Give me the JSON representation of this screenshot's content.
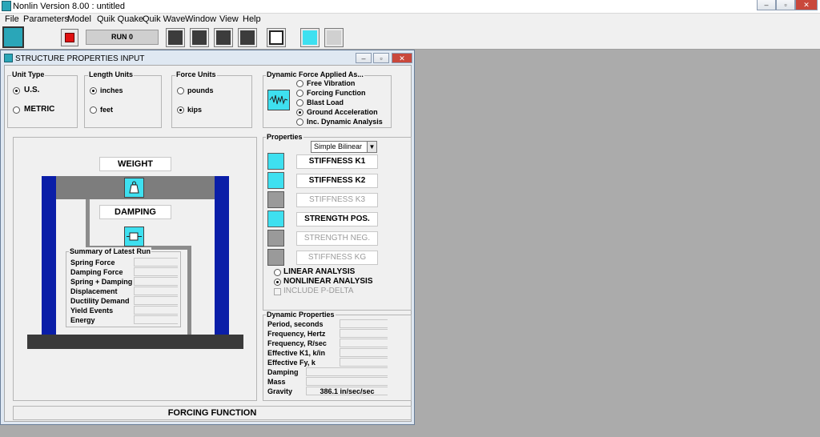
{
  "app": {
    "title": "Nonlin Version 8.00 : untitled"
  },
  "menu": [
    "File",
    "Parameters",
    "Model",
    "Quik Quake",
    "Quik Wave",
    "Window",
    "View",
    "Help"
  ],
  "toolbar": {
    "run_label": "RUN  0"
  },
  "window": {
    "title": "STRUCTURE PROPERTIES INPUT"
  },
  "unit_type": {
    "label": "Unit Type",
    "options": [
      "U.S.",
      "METRIC"
    ],
    "selected": "U.S."
  },
  "length_units": {
    "label": "Length Units",
    "options": [
      "inches",
      "feet"
    ],
    "selected": "inches"
  },
  "force_units": {
    "label": "Force Units",
    "options": [
      "pounds",
      "kips"
    ],
    "selected": "kips"
  },
  "dynamic_force": {
    "label": "Dynamic Force Applied As...",
    "options": [
      "Free Vibration",
      "Forcing Function",
      "Blast Load",
      "Ground Acceleration",
      "Inc. Dynamic Analysis"
    ],
    "selected": "Ground Acceleration"
  },
  "diagram": {
    "weight_label": "WEIGHT",
    "damping_label": "DAMPING"
  },
  "summary": {
    "title": "Summary of Latest Run",
    "rows": [
      "Spring Force",
      "Damping Force",
      "Spring + Damping",
      "Displacement",
      "Ductility Demand",
      "Yield Events",
      "Energy"
    ]
  },
  "properties": {
    "label": "Properties",
    "model_select": "Simple Bilinear",
    "fields": [
      "STIFFNESS K1",
      "STIFFNESS K2",
      "STIFFNESS K3",
      "STRENGTH POS.",
      "STRENGTH NEG.",
      "STIFFNESS KG"
    ],
    "enabled": [
      true,
      true,
      false,
      true,
      false,
      false
    ],
    "analysis_options": [
      "LINEAR ANALYSIS",
      "NONLINEAR ANALYSIS"
    ],
    "analysis_selected": "NONLINEAR ANALYSIS",
    "p_delta_label": "INCLUDE P-DELTA"
  },
  "dynamic_properties": {
    "label": "Dynamic Properties",
    "rows": [
      {
        "label": "Period, seconds",
        "value": ""
      },
      {
        "label": "Frequency, Hertz",
        "value": ""
      },
      {
        "label": "Frequency, R/sec",
        "value": ""
      },
      {
        "label": "Effective K1, k/in",
        "value": ""
      },
      {
        "label": "Effective Fy, k",
        "value": ""
      },
      {
        "label": "Damping",
        "value": ""
      },
      {
        "label": "Mass",
        "value": ""
      },
      {
        "label": "Gravity",
        "value": "386.1 in/sec/sec"
      }
    ]
  },
  "footer": {
    "forcing_function_label": "FORCING FUNCTION"
  },
  "colors": {
    "column_blue": "#0a1ea8",
    "beam_gray": "#7d7d7d",
    "icon_cyan": "#3ee0f0"
  }
}
